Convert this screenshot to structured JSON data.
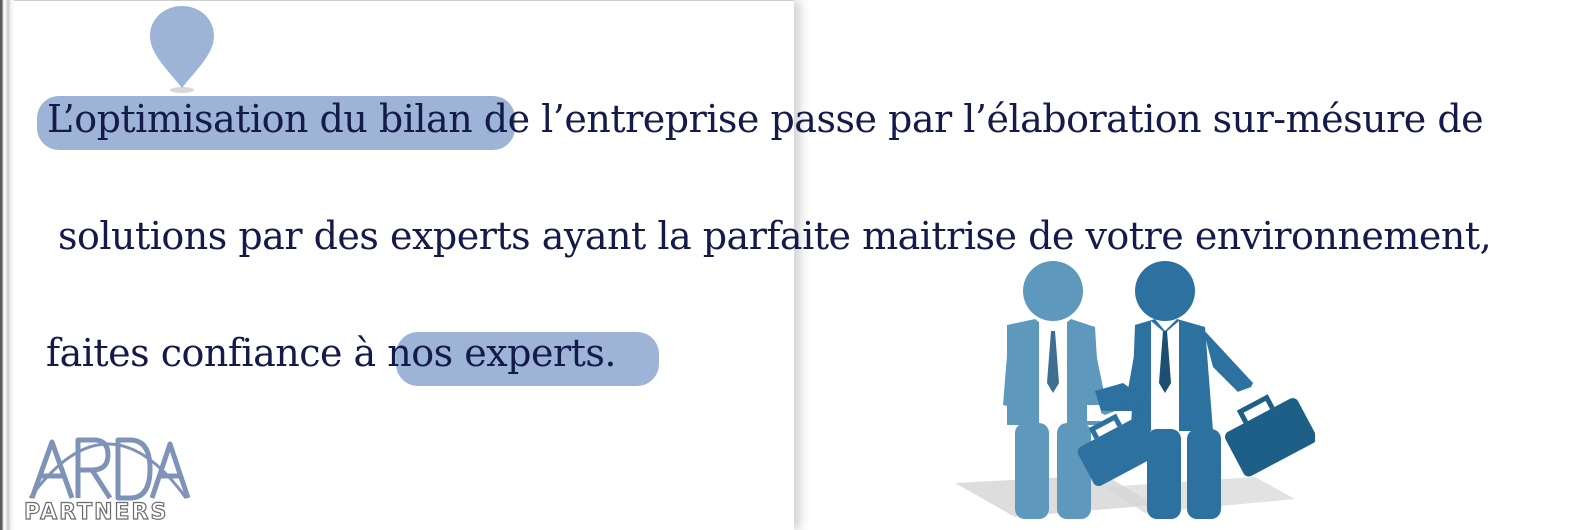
{
  "slide": {
    "lines": [
      "L’optimisation du bilan de l’entreprise passe par l’élaboration sur-mésure de",
      "solutions par des experts ayant la parfaite maitrise de votre environnement,",
      "faites confiance à nos experts."
    ]
  },
  "logo": {
    "monogram": "ARDA",
    "word": "PARTNERS"
  },
  "illustration": {
    "icon": "businessmen-handshake-icon"
  },
  "colors": {
    "text": "#141a4a",
    "highlight": "#9db4d6",
    "figure_light": "#5f98bd",
    "figure_dark": "#2c71a0",
    "briefcase": "#1d5f86"
  }
}
